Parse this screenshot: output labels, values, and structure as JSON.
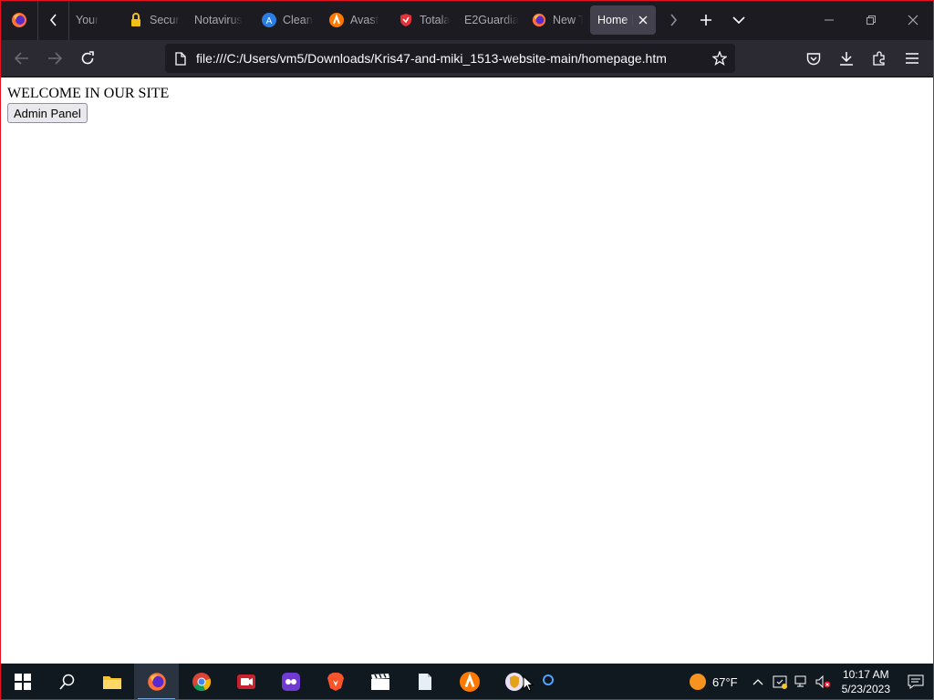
{
  "browser": {
    "tabs": [
      {
        "label": "Your",
        "icon": "lock-icon"
      },
      {
        "label": "Secur",
        "icon": "padlock-icon"
      },
      {
        "label": "Notavirus",
        "icon": ""
      },
      {
        "label": "Clean",
        "icon": "clean-app-icon"
      },
      {
        "label": "Avast",
        "icon": "avast-icon"
      },
      {
        "label": "Totala",
        "icon": "totalav-shield-icon"
      },
      {
        "label": "E2Guardia",
        "icon": ""
      },
      {
        "label": "New T",
        "icon": "firefox-icon"
      },
      {
        "label": "Home |",
        "icon": "",
        "active": true
      }
    ],
    "url": "file:///C:/Users/vm5/Downloads/Kris47-and-miki_1513-website-main/homepage.htm"
  },
  "page": {
    "welcome": "WELCOME IN OUR SITE",
    "admin_button": "Admin Panel"
  },
  "taskbar": {
    "weather": "67°F",
    "time": "10:17 AM",
    "date": "5/23/2023"
  },
  "colors": {
    "tab_strip": "#1c1b22",
    "nav_bar": "#2b2a33",
    "active_tab": "#42414d",
    "taskbar": "#101820",
    "window_border": "#e81123"
  }
}
